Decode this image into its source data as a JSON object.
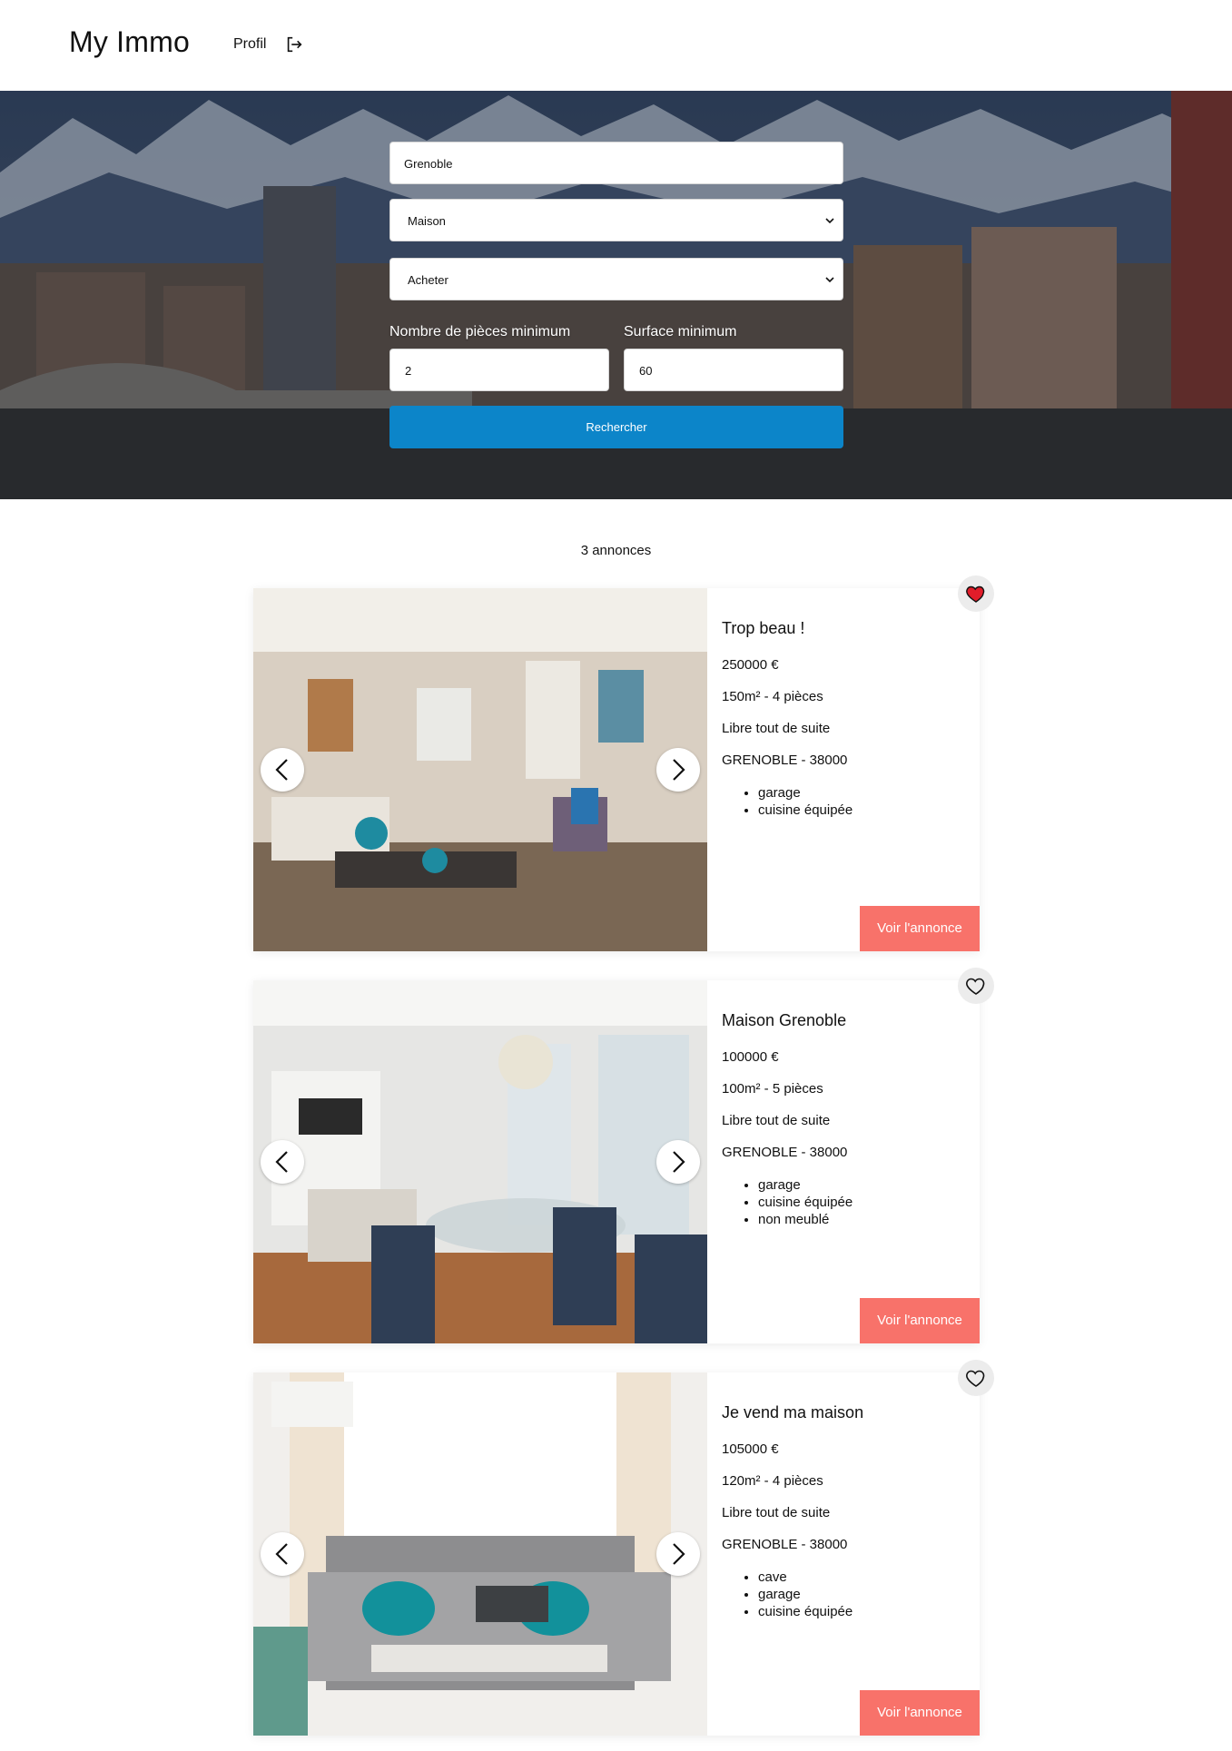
{
  "header": {
    "brand": "My Immo",
    "profile_label": "Profil"
  },
  "search": {
    "city_value": "Grenoble",
    "type_value": "Maison",
    "transaction_value": "Acheter",
    "rooms_label": "Nombre de pièces minimum",
    "rooms_value": "2",
    "surface_label": "Surface minimum",
    "surface_value": "60",
    "submit_label": "Rechercher"
  },
  "results": {
    "count_label": "3 annonces"
  },
  "listings": [
    {
      "title": "Trop beau !",
      "price": "250000 €",
      "size": "150m² - 4 pièces",
      "availability": "Libre tout de suite",
      "location": "GRENOBLE - 38000",
      "features": [
        "garage",
        "cuisine équipée"
      ],
      "favorite": true,
      "cta": "Voir l'annonce"
    },
    {
      "title": "Maison Grenoble",
      "price": "100000 €",
      "size": "100m² - 5 pièces",
      "availability": "Libre tout de suite",
      "location": "GRENOBLE - 38000",
      "features": [
        "garage",
        "cuisine équipée",
        "non meublé"
      ],
      "favorite": false,
      "cta": "Voir l'annonce"
    },
    {
      "title": "Je vend ma maison",
      "price": "105000 €",
      "size": "120m² - 4 pièces",
      "availability": "Libre tout de suite",
      "location": "GRENOBLE - 38000",
      "features": [
        "cave",
        "garage",
        "cuisine équipée"
      ],
      "favorite": false,
      "cta": "Voir l'annonce"
    }
  ],
  "colors": {
    "primary_button": "#0c85c9",
    "cta_button": "#f8726a",
    "favorite_active": "#e11d2a"
  }
}
